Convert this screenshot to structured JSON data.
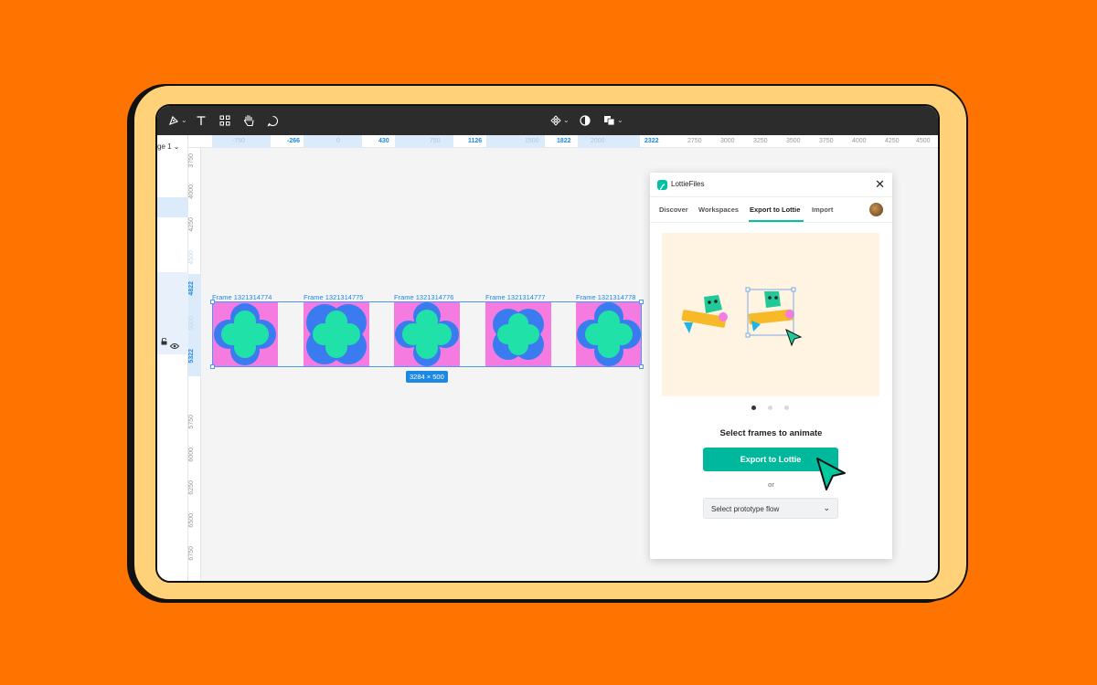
{
  "toolbar": {
    "tools": [
      "pen-tool-icon",
      "text-tool-icon",
      "components-icon",
      "hand-tool-icon",
      "comment-icon"
    ],
    "center_tools": [
      "component-icon",
      "contrast-icon",
      "boolean-icon"
    ]
  },
  "left_panel": {
    "page_label": "ge 1 ⌄"
  },
  "ruler_top": {
    "labels": [
      "-750",
      "-266",
      "0",
      "430",
      "750",
      "1126",
      "1500",
      "1822",
      "2000",
      "2322",
      "2750",
      "3000",
      "3250",
      "3500",
      "3750",
      "4000",
      "4250",
      "4500"
    ]
  },
  "ruler_left": {
    "labels": [
      "3750",
      "4000",
      "4250",
      "4500",
      "4822",
      "5000",
      "5322",
      "5750",
      "6000",
      "6250",
      "6500",
      "6750"
    ]
  },
  "canvas": {
    "frames": [
      {
        "label": "Frame 1321314774"
      },
      {
        "label": "Frame 1321314775"
      },
      {
        "label": "Frame 1321314776"
      },
      {
        "label": "Frame 1321314777"
      },
      {
        "label": "Frame 1321314778"
      }
    ],
    "selection_size": "3284 × 500",
    "colors": {
      "frame_bg": "#F57BE0",
      "flower_outer": "#3B7BF0",
      "flower_inner": "#20E2A8",
      "selection": "#1E88E5"
    }
  },
  "plugin": {
    "title": "LottieFiles",
    "close_label": "✕",
    "tabs": [
      {
        "label": "Discover",
        "active": false
      },
      {
        "label": "Workspaces",
        "active": false
      },
      {
        "label": "Export to Lottie",
        "active": true
      },
      {
        "label": "Import",
        "active": false
      }
    ],
    "carousel": {
      "count": 3,
      "active": 0
    },
    "heading": "Select frames to animate",
    "export_button": "Export to Lottie",
    "or_text": "or",
    "select_label": "Select prototype flow",
    "select_chevron": "⌄",
    "accent": "#00B99C"
  }
}
